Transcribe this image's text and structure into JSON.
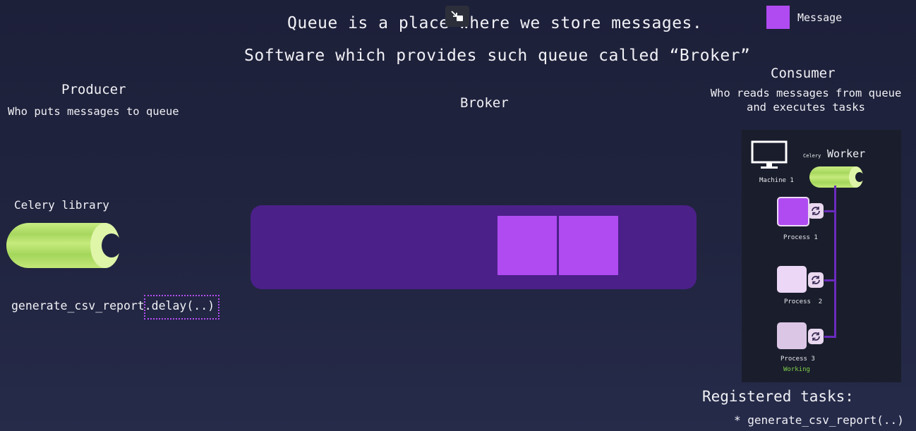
{
  "header": {
    "line1": "Queue is a place where we store messages.",
    "line2": "Software which provides such queue called “Broker”"
  },
  "legend": {
    "label": "Message",
    "color": "#b04bf2"
  },
  "producer": {
    "title": "Producer",
    "subtitle": "Who puts messages to queue",
    "library_label": "Celery library",
    "code_prefix": "generate_csv_report",
    "code_suffix": ".delay(..)"
  },
  "broker": {
    "title": "Broker",
    "bar_color": "#4b2089",
    "message_count": 2
  },
  "consumer": {
    "title": "Consumer",
    "subtitle_line1": "Who reads messages from queue",
    "subtitle_line2": "and executes tasks",
    "machine_label": "Machine 1",
    "celery_small": "Celery",
    "worker_label": "Worker",
    "processes": [
      {
        "label": "Process 1",
        "status": ""
      },
      {
        "label": "Process  2",
        "status": ""
      },
      {
        "label": "Process 3",
        "status": "Working"
      }
    ],
    "registered_title": "Registered tasks:",
    "registered_items": [
      "* generate_csv_report(..)"
    ]
  },
  "colors": {
    "background": "#1f2340",
    "message": "#b04bf2",
    "celery_green": "#b6e36d",
    "working_green": "#7fd04a"
  },
  "icons": [
    "minimize-icon",
    "celery-logo-icon",
    "monitor-icon",
    "refresh-icon"
  ]
}
